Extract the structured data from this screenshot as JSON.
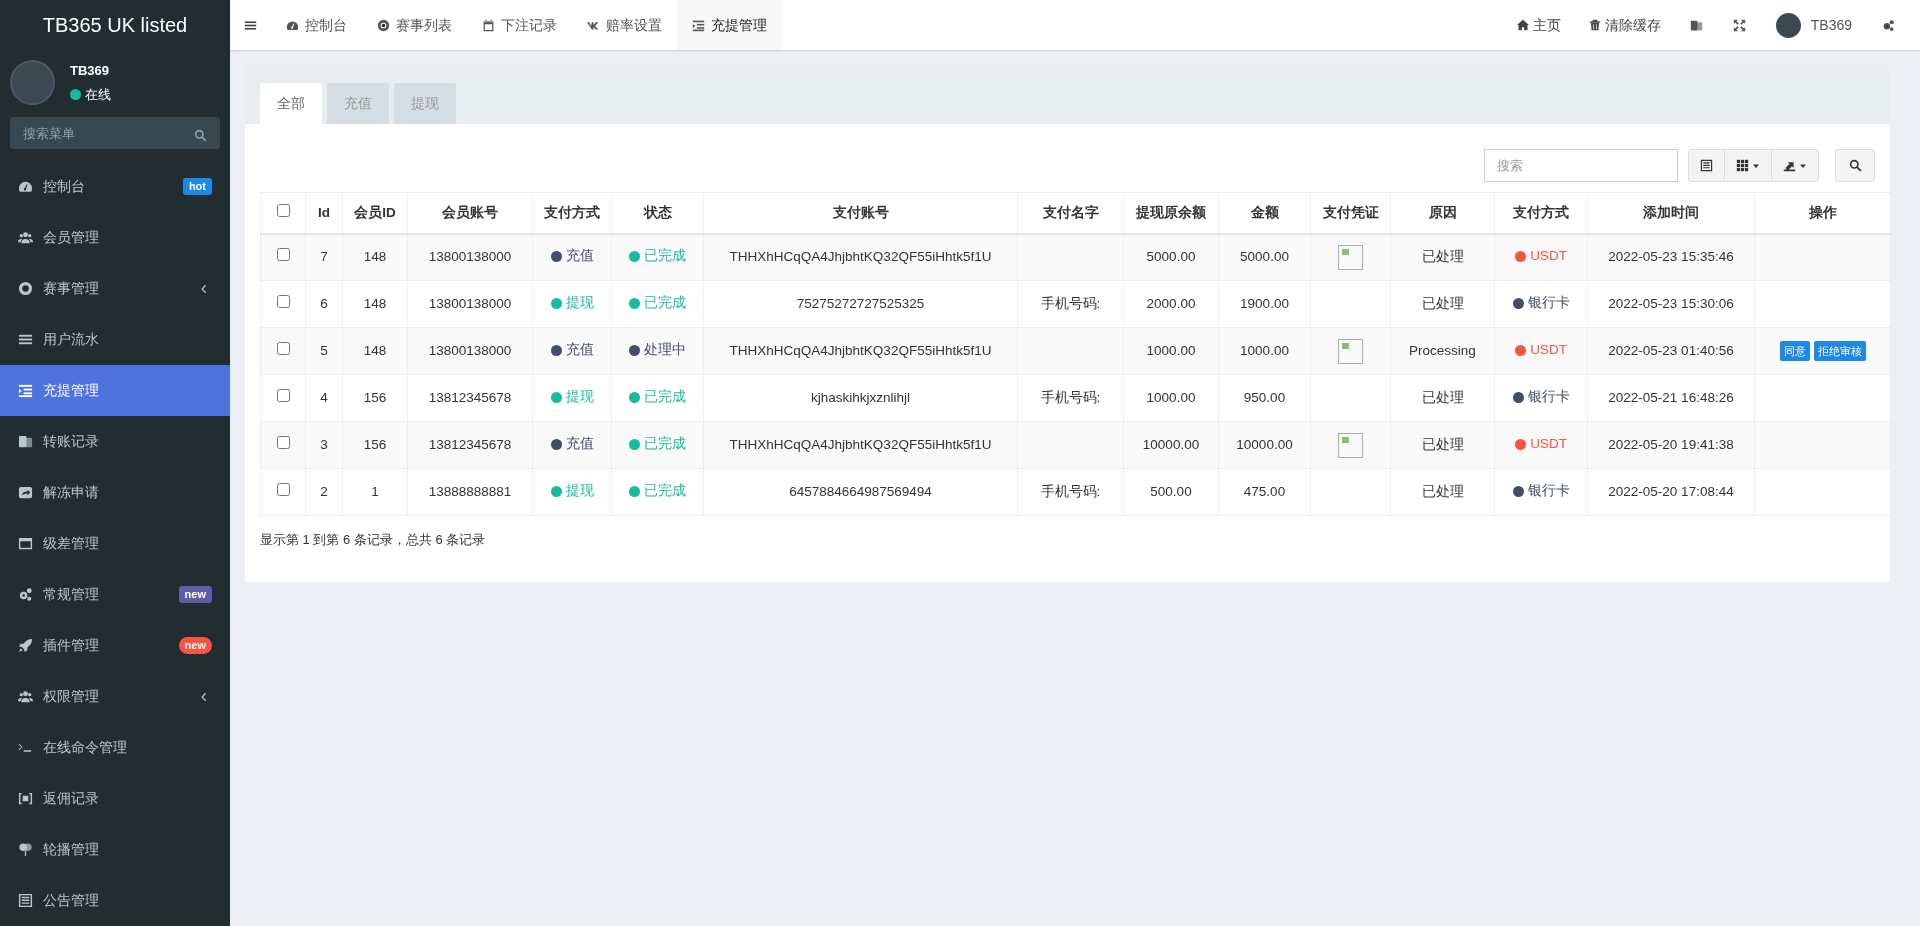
{
  "sidebar": {
    "brand": "TB365 UK listed",
    "user": {
      "name": "TB369",
      "status": "在线"
    },
    "search": {
      "placeholder": "搜索菜单"
    },
    "items": [
      {
        "label": "控制台",
        "selected": false,
        "expandable": false,
        "badge": {
          "text": "hot",
          "color": "#1e88e5"
        }
      },
      {
        "label": "会员管理",
        "selected": false,
        "expandable": false
      },
      {
        "label": "赛事管理",
        "selected": false,
        "expandable": true
      },
      {
        "label": "用户流水",
        "selected": false,
        "expandable": false
      },
      {
        "label": "充提管理",
        "selected": true,
        "expandable": false
      },
      {
        "label": "转账记录",
        "selected": false,
        "expandable": false
      },
      {
        "label": "解冻申请",
        "selected": false,
        "expandable": false
      },
      {
        "label": "级差管理",
        "selected": false,
        "expandable": false
      },
      {
        "label": "常规管理",
        "selected": false,
        "expandable": false,
        "badge": {
          "text": "new",
          "color": "#605ca8"
        }
      },
      {
        "label": "插件管理",
        "selected": false,
        "expandable": false,
        "badge": {
          "text": "new",
          "color": "#f75444"
        }
      },
      {
        "label": "权限管理",
        "selected": false,
        "expandable": true
      },
      {
        "label": "在线命令管理",
        "selected": false,
        "expandable": false
      },
      {
        "label": "返佣记录",
        "selected": false,
        "expandable": false
      },
      {
        "label": "轮播管理",
        "selected": false,
        "expandable": false
      },
      {
        "label": "公告管理",
        "selected": false,
        "expandable": false
      }
    ]
  },
  "topbar": {
    "tabs": [
      {
        "label": "控制台",
        "selected": false
      },
      {
        "label": "赛事列表",
        "selected": false
      },
      {
        "label": "下注记录",
        "selected": false
      },
      {
        "label": "赔率设置",
        "selected": false
      },
      {
        "label": "充提管理",
        "selected": true
      }
    ],
    "right": [
      {
        "kind": "link",
        "label": "主页"
      },
      {
        "kind": "link",
        "label": "清除缓存"
      },
      {
        "kind": "icon"
      },
      {
        "kind": "icon"
      },
      {
        "kind": "user",
        "label": "TB369"
      },
      {
        "kind": "icon"
      }
    ]
  },
  "content": {
    "tabs": [
      {
        "label": "全部",
        "selected": true
      },
      {
        "label": "充值",
        "selected": false
      },
      {
        "label": "提现",
        "selected": false
      }
    ],
    "search": {
      "placeholder": "搜索"
    },
    "select_all_checked": false,
    "table": {
      "columns": [
        "Id",
        "会员ID",
        "会员账号",
        "支付方式",
        "状态",
        "支付账号",
        "支付名字",
        "提现原余额",
        "金额",
        "支付凭证",
        "原因",
        "支付方式",
        "添加时间",
        "操作"
      ],
      "rows": [
        {
          "checked": false,
          "id": "7",
          "member_id": "148",
          "account": "13800138000",
          "type": {
            "text": "充值",
            "color": "#444c69"
          },
          "status": {
            "text": "已完成",
            "color": "#18bc9c"
          },
          "pay_account": "THHXhHCqQA4JhjbhtKQ32QF55iHhtk5f1U",
          "pay_name": "",
          "balance": "5000.00",
          "amount": "5000.00",
          "proof": true,
          "reason": "已处理",
          "method": {
            "text": "USDT",
            "color": "#f75444"
          },
          "time": "2022-05-23 15:35:46",
          "actions": []
        },
        {
          "checked": false,
          "id": "6",
          "member_id": "148",
          "account": "13800138000",
          "type": {
            "text": "提现",
            "color": "#18bc9c"
          },
          "status": {
            "text": "已完成",
            "color": "#18bc9c"
          },
          "pay_account": "75275272727525325",
          "pay_name": "手机号码:",
          "balance": "2000.00",
          "amount": "1900.00",
          "proof": false,
          "reason": "已处理",
          "method": {
            "text": "银行卡",
            "color": "#444c69"
          },
          "time": "2022-05-23 15:30:06",
          "actions": []
        },
        {
          "checked": false,
          "id": "5",
          "member_id": "148",
          "account": "13800138000",
          "type": {
            "text": "充值",
            "color": "#444c69"
          },
          "status": {
            "text": "处理中",
            "color": "#444c69"
          },
          "pay_account": "THHXhHCqQA4JhjbhtKQ32QF55iHhtk5f1U",
          "pay_name": "",
          "balance": "1000.00",
          "amount": "1000.00",
          "proof": true,
          "reason": "Processing",
          "method": {
            "text": "USDT",
            "color": "#f75444"
          },
          "time": "2022-05-23 01:40:56",
          "actions": [
            "同意",
            "拒绝审核"
          ]
        },
        {
          "checked": false,
          "id": "4",
          "member_id": "156",
          "account": "13812345678",
          "type": {
            "text": "提现",
            "color": "#18bc9c"
          },
          "status": {
            "text": "已完成",
            "color": "#18bc9c"
          },
          "pay_account": "kjhaskihkjxznlihjl",
          "pay_name": "手机号码:",
          "balance": "1000.00",
          "amount": "950.00",
          "proof": false,
          "reason": "已处理",
          "method": {
            "text": "银行卡",
            "color": "#444c69"
          },
          "time": "2022-05-21 16:48:26",
          "actions": []
        },
        {
          "checked": false,
          "id": "3",
          "member_id": "156",
          "account": "13812345678",
          "type": {
            "text": "充值",
            "color": "#444c69"
          },
          "status": {
            "text": "已完成",
            "color": "#18bc9c"
          },
          "pay_account": "THHXhHCqQA4JhjbhtKQ32QF55iHhtk5f1U",
          "pay_name": "",
          "balance": "10000.00",
          "amount": "10000.00",
          "proof": true,
          "reason": "已处理",
          "method": {
            "text": "USDT",
            "color": "#f75444"
          },
          "time": "2022-05-20 19:41:38",
          "actions": []
        },
        {
          "checked": false,
          "id": "2",
          "member_id": "1",
          "account": "13888888881",
          "type": {
            "text": "提现",
            "color": "#18bc9c"
          },
          "status": {
            "text": "已完成",
            "color": "#18bc9c"
          },
          "pay_account": "6457884664987569494",
          "pay_name": "手机号码:",
          "balance": "500.00",
          "amount": "475.00",
          "proof": false,
          "reason": "已处理",
          "method": {
            "text": "银行卡",
            "color": "#444c69"
          },
          "time": "2022-05-20 17:08:44",
          "actions": []
        }
      ]
    },
    "summary": "显示第 1 到第 6 条记录，总共 6 条记录"
  }
}
